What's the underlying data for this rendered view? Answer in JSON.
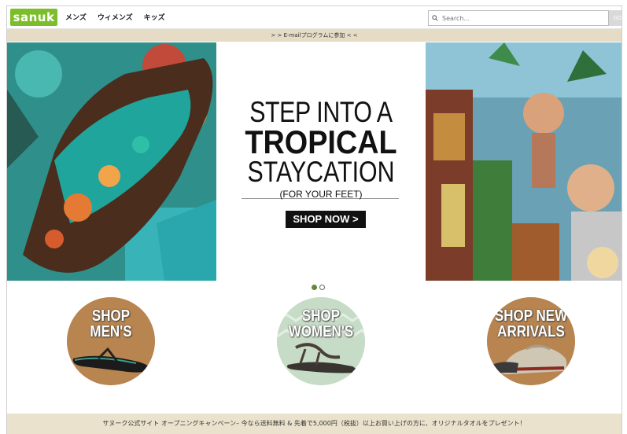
{
  "header": {
    "logo_text": "sanuk",
    "nav": [
      "メンズ",
      "ウィメンズ",
      "キッズ"
    ],
    "search_placeholder": "Search...",
    "go_label": "GO"
  },
  "promo_text": "> > E-mailプログラムに参加 < <",
  "hero": {
    "line1": "STEP INTO A",
    "line2": "TROPICAL",
    "line3": "STAYCATION",
    "line4": "(FOR YOUR FEET)",
    "cta": "SHOP NOW >"
  },
  "carousel": {
    "slides": 2,
    "active": 1
  },
  "categories": [
    {
      "line1": "SHOP",
      "line2": "MEN'S"
    },
    {
      "line1": "SHOP",
      "line2": "WOMEN'S"
    },
    {
      "line1": "SHOP NEW",
      "line2": "ARRIVALS"
    }
  ],
  "footer_text": "サヌーク公式サイト オープニングキャンペーン– 今なら送料無料 & 先着で5,000円（税抜）以上お買い上げの方に、オリジナルタオルをプレゼント！",
  "colors": {
    "brand_green": "#7cbd2c",
    "promo_bg": "#e6dcc6",
    "footer_bg": "#ebe2cd",
    "active_dot": "#5d8a3b"
  }
}
